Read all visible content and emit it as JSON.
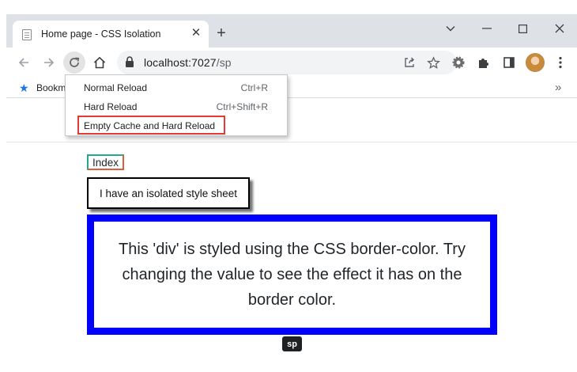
{
  "browser": {
    "tab": {
      "title": "Home page - CSS Isolation",
      "close_symbol": "✕"
    },
    "new_tab_symbol": "+",
    "window_controls": [
      "chevron-down-icon",
      "minimize-icon",
      "maximize-icon",
      "close-icon"
    ],
    "toolbar": {
      "url_host": "localhost:7027",
      "url_path": "/sp",
      "icons": [
        "back-icon",
        "forward-icon",
        "reload-icon",
        "home-icon",
        "lock-icon",
        "share-icon",
        "star-icon",
        "extension-gear-icon",
        "puzzle-icon",
        "side-panel-icon",
        "avatar",
        "kebab-menu-icon"
      ]
    },
    "bookmarks": {
      "label": "Bookm",
      "more_symbol": "»"
    }
  },
  "reload_menu": {
    "items": [
      {
        "label": "Normal Reload",
        "shortcut": "Ctrl+R"
      },
      {
        "label": "Hard Reload",
        "shortcut": "Ctrl+Shift+R"
      },
      {
        "label": "Empty Cache and Hard Reload",
        "shortcut": ""
      }
    ],
    "highlight_color": "#e53935"
  },
  "page": {
    "index_link": "Index",
    "isolated_box_text": "I have an isolated style sheet",
    "border_div_text": "This 'div' is styled using the CSS border-color. Try changing the value to see the effect it has on the border color.",
    "border_color": "#0000ff",
    "tooltip": "sp"
  }
}
